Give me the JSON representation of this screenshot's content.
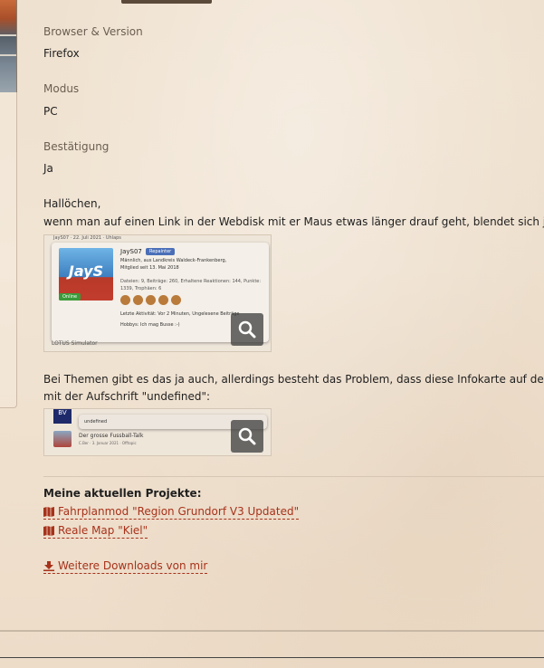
{
  "fields": [
    {
      "label": "Browser & Version",
      "value": "Firefox"
    },
    {
      "label": "Modus",
      "value": "PC"
    },
    {
      "label": "Bestätigung",
      "value": "Ja"
    }
  ],
  "post": {
    "greeting": "Hallöchen,",
    "line1": "wenn man auf einen Link in der Webdisk mit er Maus etwas länger drauf geht, blendet sich ja se",
    "line2": "Bei Themen gibt es das ja auch, allerdings besteht das Problem, dass diese Infokarte auf der Se",
    "line3": "mit der Aufschrift \"undefined\":"
  },
  "attachment1": {
    "header": "JayS07 · 22. Juli 2021 · Uhlaps",
    "user": "JayS07",
    "badge": "Repainter",
    "bio": "Männlich, aus Landkreis Waldeck-Frankenberg,",
    "member": "Mitglied seit 13. Mai 2018",
    "stats": "Dateien: 9, Beiträge: 260, Erhaltene Reaktionen: 144, Punkte:",
    "stats2": "1339, Trophäen: 6",
    "activity": "Letzte Aktivität: Vor 2 Minuten, Ungelesene Beiträge",
    "hobby": "Hobbys: Ich mag Busse :-)",
    "online": "Online",
    "footer": "LOTUS Simulator"
  },
  "attachment2": {
    "card_title": "undefined",
    "topic": "Der grosse Fussball-Talk",
    "meta": "C.Ber · 3. Januar 2021 · Offtopic",
    "avatar_text": "BV"
  },
  "signature": {
    "title": "Meine aktuellen Projekte:",
    "links": [
      {
        "icon": "map-icon",
        "label": "Fahrplanmod \"Region Grundorf V3 Updated\""
      },
      {
        "icon": "map-icon",
        "label": "Reale Map \"Kiel\""
      }
    ],
    "downloads": {
      "icon": "download-icon",
      "label": "Weitere Downloads von mir"
    }
  },
  "colors": {
    "accent": "#a7321b",
    "label": "#6a5e52"
  }
}
